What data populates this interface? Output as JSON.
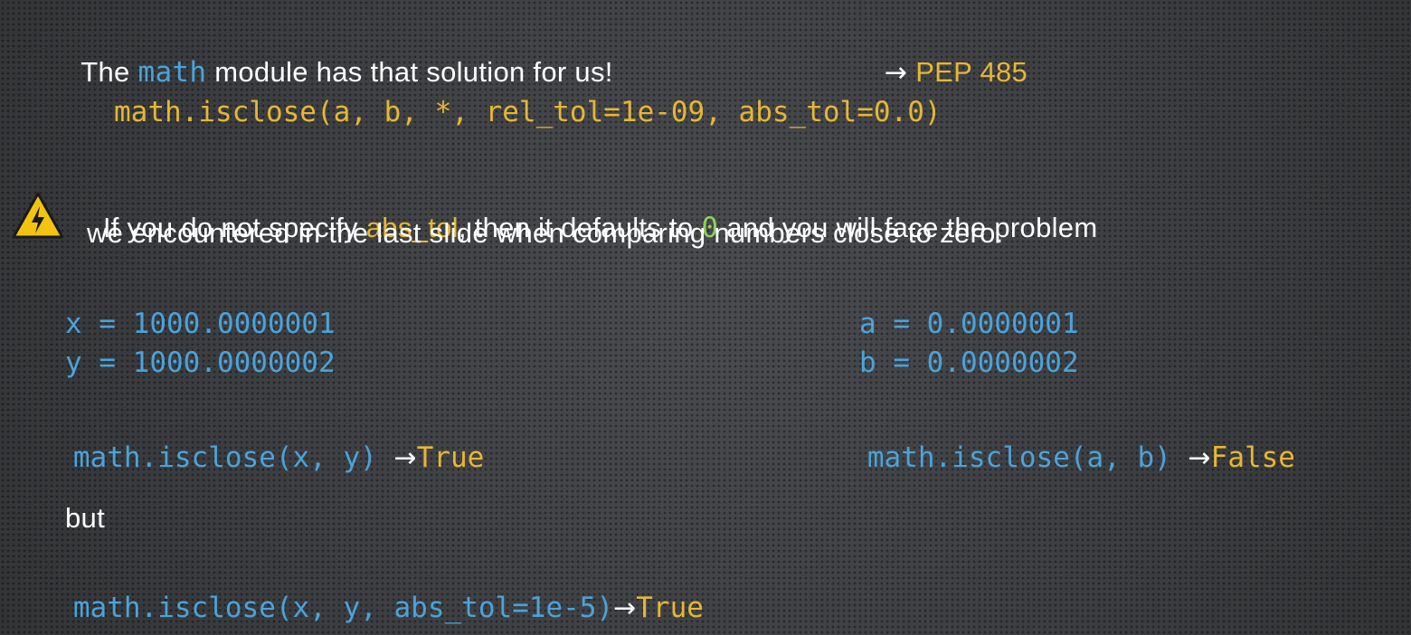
{
  "intro": {
    "prefix": "The ",
    "module": "math",
    "suffix": " module has that solution for us!",
    "arrow": "→",
    "pep": "PEP 485"
  },
  "signature": "math.isclose(a, b, *, rel_tol=1e-09, abs_tol=0.0)",
  "warning": {
    "icon": "warning-icon",
    "part1": "If you do not specify ",
    "abs_tol": "abs_tol",
    "part2": ", then it defaults to ",
    "zero": "0",
    "part3": " and you will face the problem",
    "line2": "we encountered in the last slide when comparing numbers close to zero."
  },
  "left_example": {
    "x_line": "x = 1000.0000001",
    "y_line": "y = 1000.0000002",
    "call": "math.isclose(x, y)",
    "arrow": "→",
    "result": "True"
  },
  "right_example": {
    "a_line": "a = 0.0000001",
    "b_line": "b = 0.0000002",
    "call": "math.isclose(a, b)",
    "arrow": "→",
    "result": "False"
  },
  "but": "but",
  "final": {
    "call": "math.isclose(x, y, abs_tol=1e-5)",
    "arrow": "→",
    "result": "True"
  },
  "colors": {
    "code_blue": "#4ba3da",
    "accent_yellow": "#e6b732",
    "zero_green": "#8fcf5c",
    "text": "#ffffff"
  }
}
